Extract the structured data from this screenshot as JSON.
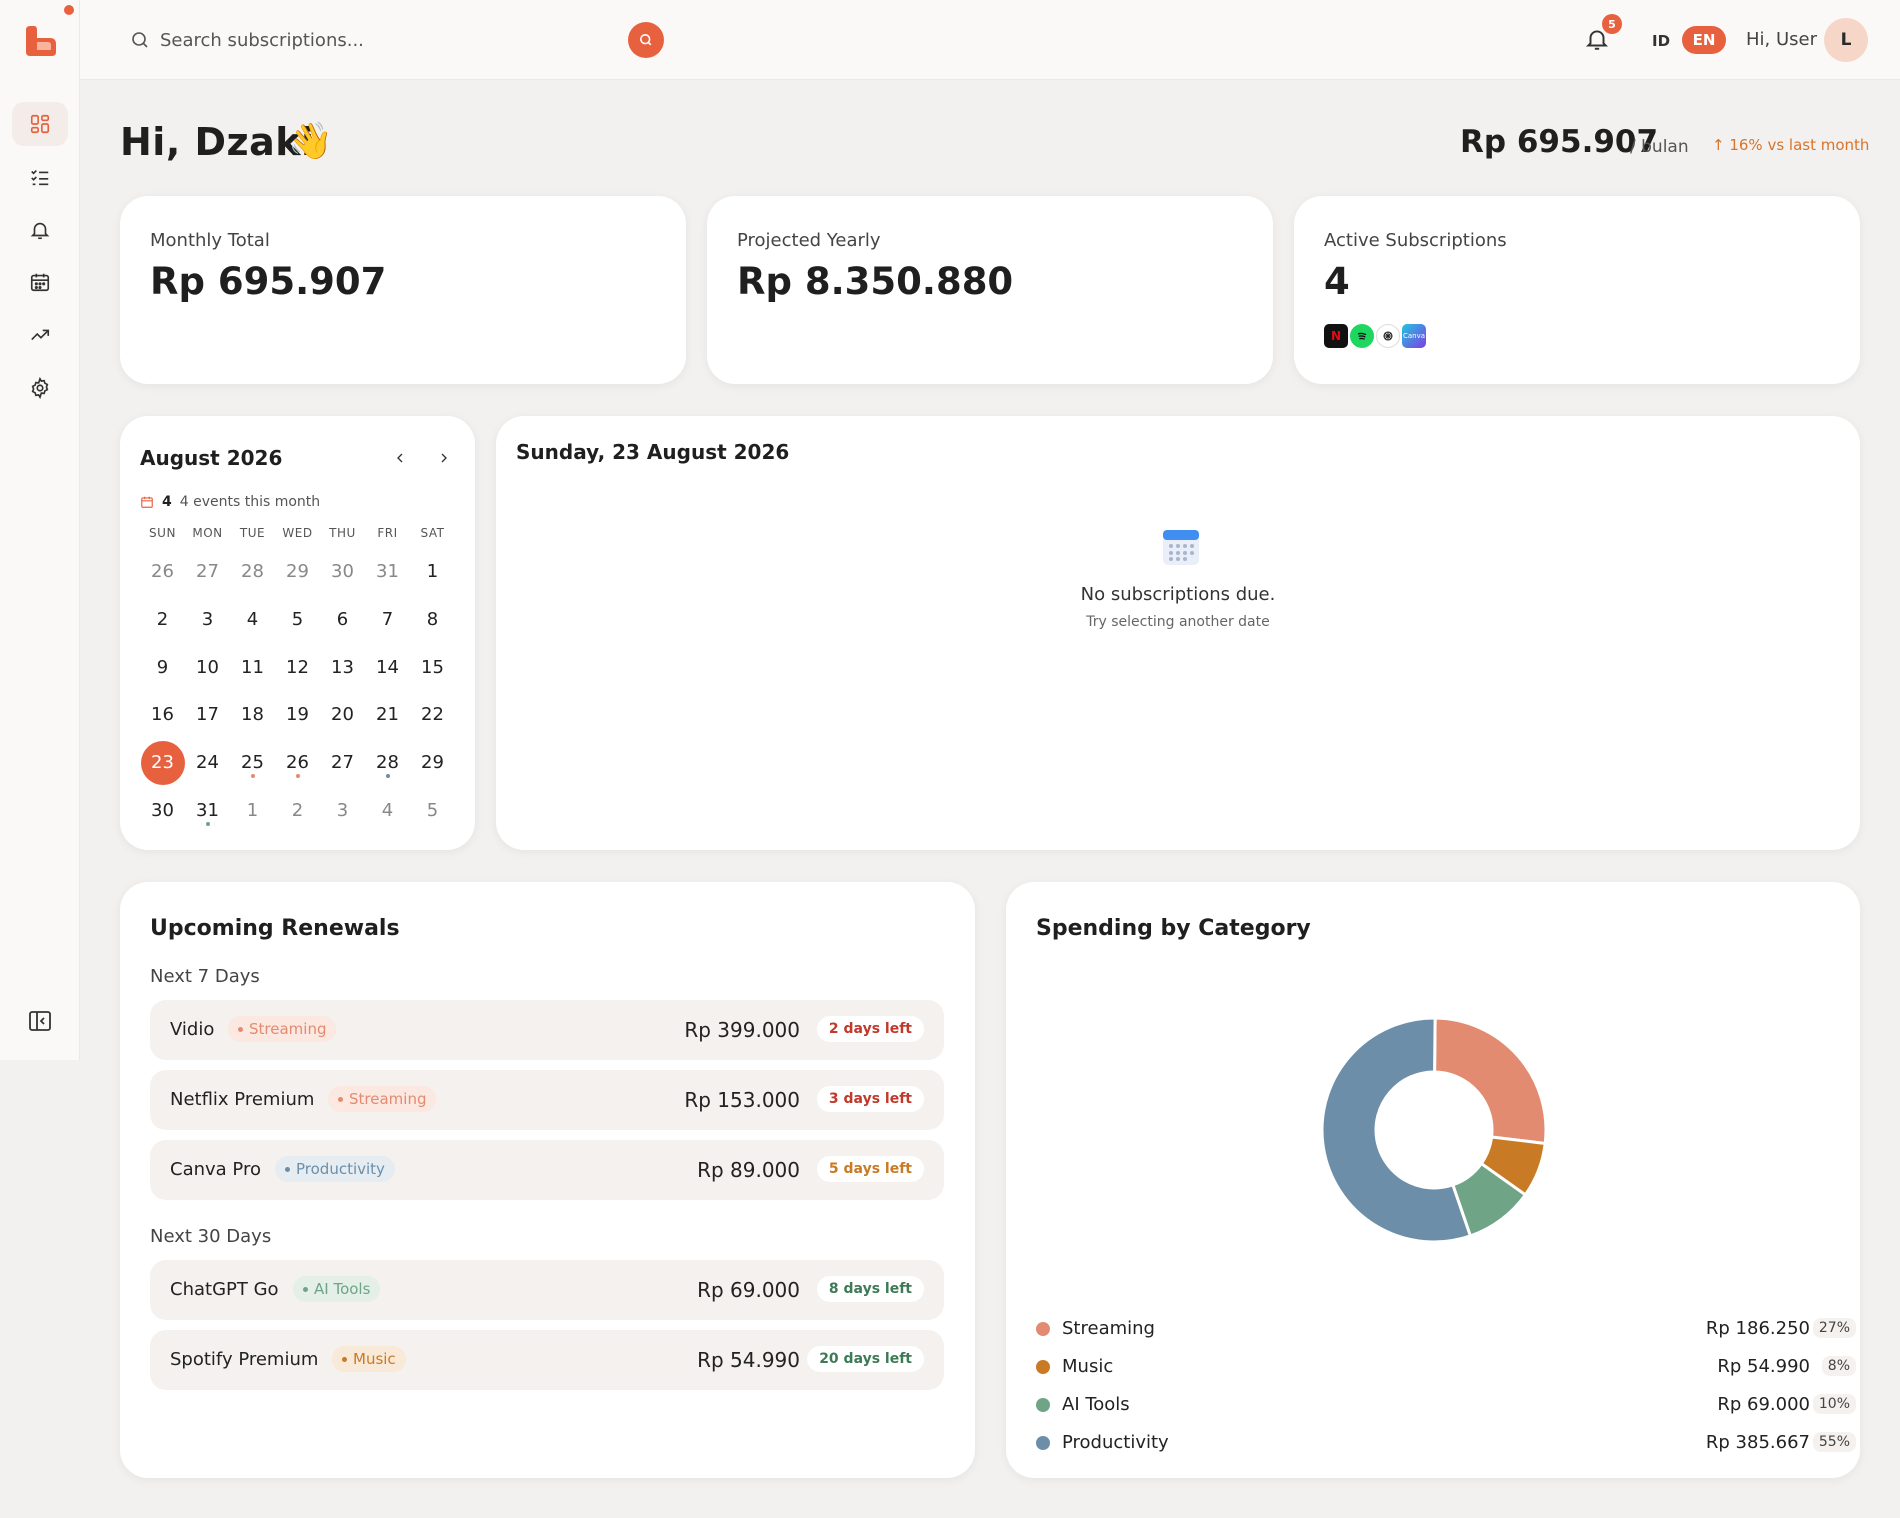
{
  "colors": {
    "accent": "#e8613f",
    "streaming": "#e38b70",
    "music": "#c97a24",
    "ai_tools": "#6fa487",
    "productivity": "#6c8ea8"
  },
  "sidebar": {
    "items": [
      {
        "name": "dashboard-icon",
        "active": true
      },
      {
        "name": "subscriptions-list-icon",
        "active": false
      },
      {
        "name": "notifications-icon",
        "active": false
      },
      {
        "name": "calendar-icon",
        "active": false
      },
      {
        "name": "analytics-trend-icon",
        "active": false
      },
      {
        "name": "settings-gear-icon",
        "active": false
      }
    ],
    "toggle_icon": "sidebar-collapse-icon"
  },
  "topbar": {
    "search_placeholder": "Search subscriptions...",
    "notification_count": "5",
    "lang_id": "ID",
    "lang_en": "EN",
    "greeting": "Hi, User",
    "avatar_initial": "L"
  },
  "header": {
    "title": "Hi, Dzaki",
    "wave": "👋",
    "total": "Rp 695.907",
    "unit": "/ bulan",
    "trend": "↑ 16% vs last month"
  },
  "stats": [
    {
      "label": "Monthly Total",
      "value": "Rp 695.907"
    },
    {
      "label": "Projected Yearly",
      "value": "Rp 8.350.880"
    },
    {
      "label": "Active Subscriptions",
      "value": "4"
    }
  ],
  "active_apps": [
    "netflix-icon",
    "spotify-icon",
    "chatgpt-icon",
    "canva-icon"
  ],
  "calendar": {
    "month_label": "August 2026",
    "events_count": "4",
    "events_text": "4 events this month",
    "weekdays": [
      "SUN",
      "MON",
      "TUE",
      "WED",
      "THU",
      "FRI",
      "SAT"
    ],
    "days": [
      {
        "d": "26",
        "muted": true
      },
      {
        "d": "27",
        "muted": true
      },
      {
        "d": "28",
        "muted": true
      },
      {
        "d": "29",
        "muted": true
      },
      {
        "d": "30",
        "muted": true
      },
      {
        "d": "31",
        "muted": true
      },
      {
        "d": "1"
      },
      {
        "d": "2"
      },
      {
        "d": "3"
      },
      {
        "d": "4"
      },
      {
        "d": "5"
      },
      {
        "d": "6"
      },
      {
        "d": "7"
      },
      {
        "d": "8"
      },
      {
        "d": "9"
      },
      {
        "d": "10"
      },
      {
        "d": "11"
      },
      {
        "d": "12"
      },
      {
        "d": "13"
      },
      {
        "d": "14"
      },
      {
        "d": "15"
      },
      {
        "d": "16"
      },
      {
        "d": "17"
      },
      {
        "d": "18"
      },
      {
        "d": "19"
      },
      {
        "d": "20"
      },
      {
        "d": "21"
      },
      {
        "d": "22"
      },
      {
        "d": "23",
        "selected": true
      },
      {
        "d": "24"
      },
      {
        "d": "25",
        "dot": "#e38b70"
      },
      {
        "d": "26",
        "dot": "#e38b70"
      },
      {
        "d": "27"
      },
      {
        "d": "28",
        "dot": "#6c8ea8"
      },
      {
        "d": "29"
      },
      {
        "d": "30"
      },
      {
        "d": "31",
        "dot": "#6fa487"
      },
      {
        "d": "1",
        "muted": true
      },
      {
        "d": "2",
        "muted": true
      },
      {
        "d": "3",
        "muted": true
      },
      {
        "d": "4",
        "muted": true
      },
      {
        "d": "5",
        "muted": true
      }
    ]
  },
  "day_detail": {
    "title": "Sunday, 23 August 2026",
    "empty_title": "No subscriptions due.",
    "empty_sub": "Try selecting another date"
  },
  "renewals": {
    "title": "Upcoming Renewals",
    "groups": [
      {
        "label": "Next 7 Days",
        "items": [
          {
            "name": "Vidio",
            "tag": "Streaming",
            "tag_color": "#e38b70",
            "tag_bg": "#fbe8e1",
            "amount": "Rp 399.000",
            "left": "2 days left",
            "left_color": "#c0392b"
          },
          {
            "name": "Netflix Premium",
            "tag": "Streaming",
            "tag_color": "#e38b70",
            "tag_bg": "#fbe8e1",
            "amount": "Rp 153.000",
            "left": "3 days left",
            "left_color": "#c0392b"
          },
          {
            "name": "Canva Pro",
            "tag": "Productivity",
            "tag_color": "#6c8ea8",
            "tag_bg": "#e6edf2",
            "amount": "Rp 89.000",
            "left": "5 days left",
            "left_color": "#c97a24"
          }
        ]
      },
      {
        "label": "Next 30 Days",
        "items": [
          {
            "name": "ChatGPT Go",
            "tag": "AI Tools",
            "tag_color": "#6fa487",
            "tag_bg": "#e4efe8",
            "amount": "Rp 69.000",
            "left": "8 days left",
            "left_color": "#3d7a55"
          },
          {
            "name": "Spotify Premium",
            "tag": "Music",
            "tag_color": "#c97a24",
            "tag_bg": "#f8e9d8",
            "amount": "Rp 54.990",
            "left": "20 days left",
            "left_color": "#3d7a55"
          }
        ]
      }
    ]
  },
  "spending": {
    "title": "Spending by Category"
  },
  "chart_data": {
    "type": "pie",
    "title": "Spending by Category",
    "categories": [
      "Streaming",
      "Music",
      "AI Tools",
      "Productivity"
    ],
    "values": [
      186250,
      54990,
      69000,
      385667
    ],
    "value_labels": [
      "Rp 186.250",
      "Rp 54.990",
      "Rp 69.000",
      "Rp 385.667"
    ],
    "percents": [
      "27%",
      "8%",
      "10%",
      "55%"
    ],
    "colors": [
      "#e38b70",
      "#c97a24",
      "#6fa487",
      "#6c8ea8"
    ],
    "donut": true,
    "legend": "bottom"
  }
}
